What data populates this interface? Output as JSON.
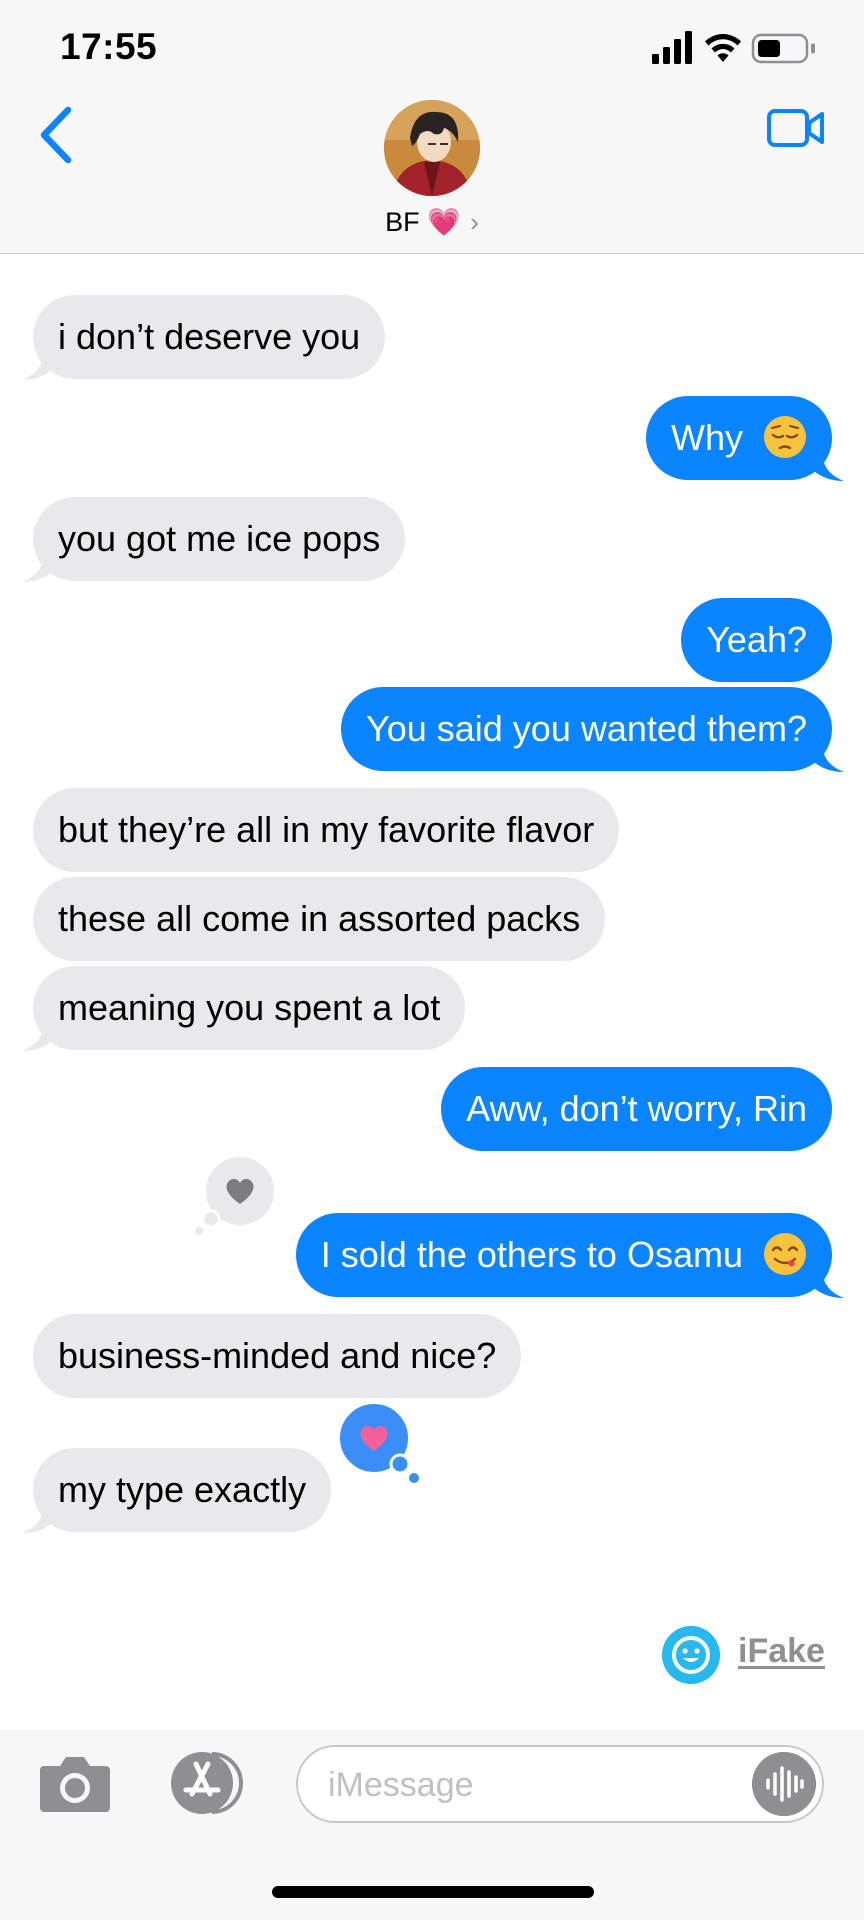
{
  "status_bar": {
    "time": "17:55"
  },
  "header": {
    "contact_name": "BF",
    "contact_emoji": "💗",
    "chevron": "›"
  },
  "messages": [
    {
      "dir": "received",
      "text": "i don’t deserve you"
    },
    {
      "dir": "sent",
      "text": "Why",
      "emoji": "pensive-face-emoji"
    },
    {
      "dir": "received",
      "text": "you got me ice pops"
    },
    {
      "dir": "sent",
      "text": "Yeah?"
    },
    {
      "dir": "sent",
      "text": "You said you wanted them?"
    },
    {
      "dir": "received",
      "text": "but they’re all in my favorite flavor"
    },
    {
      "dir": "received",
      "text": "these all come in assorted packs"
    },
    {
      "dir": "received",
      "text": "meaning you spent a lot"
    },
    {
      "dir": "sent",
      "text": "Aww, don’t worry, Rin"
    },
    {
      "dir": "sent",
      "text": "I sold the others to Osamu",
      "emoji": "yum-face-emoji",
      "reaction": "heart"
    },
    {
      "dir": "received",
      "text": "business-minded and nice?"
    },
    {
      "dir": "received",
      "text": "my type exactly",
      "reaction": "heart"
    }
  ],
  "watermark": {
    "text": "iFake"
  },
  "input": {
    "placeholder": "iMessage",
    "value": ""
  },
  "colors": {
    "sent_bubble": "#0a84ff",
    "received_bubble": "#e9e9eb",
    "accent": "#0a84ff",
    "reaction_blue": "#3a8ef6",
    "reaction_pink": "#f0609a"
  }
}
